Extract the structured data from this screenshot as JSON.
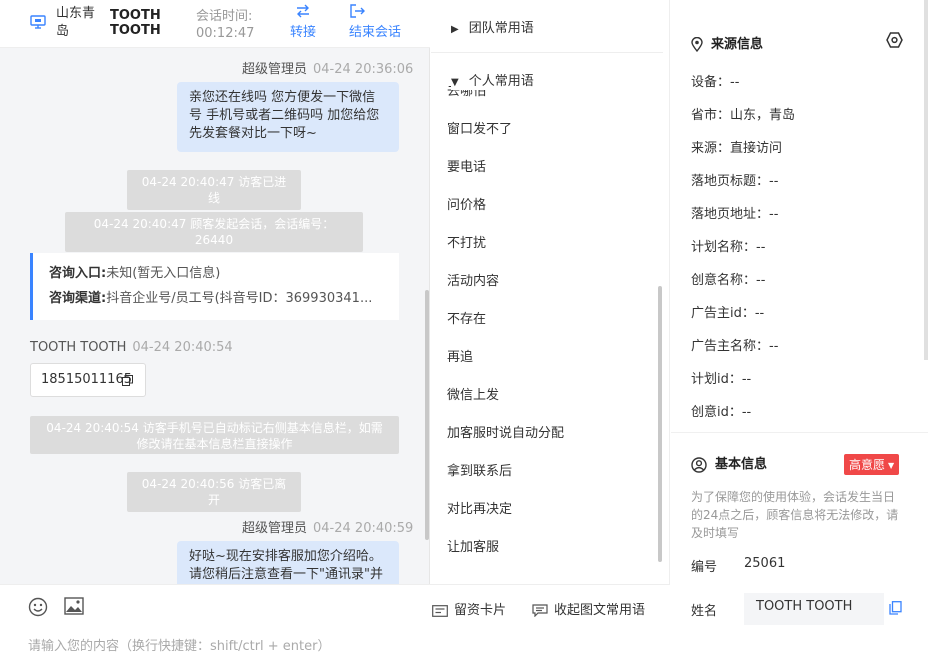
{
  "header": {
    "location": "山东青岛",
    "customer_name": "TOOTH TOOTH",
    "session_time_label": "会话时间:",
    "session_time": "00:12:47",
    "transfer_label": "转接",
    "end_label": "结束会话"
  },
  "messages": {
    "m1_sender": "超级管理员",
    "m1_time": "04-24 20:36:06",
    "m1_text": "亲您还在线吗 您方便发一下微信号 手机号或者二维码吗 加您给您先发套餐对比一下呀~",
    "sys1": "04-24 20:40:47 访客已进线",
    "sys2": "04-24 20:40:47 顾客发起会话，会话编号：26440",
    "source_entry_label": "咨询入口:",
    "source_entry_value": "未知(暂无入口信息)",
    "source_channel_label": "咨询渠道:",
    "source_channel_value": "抖音企业号/员工号(抖音号ID：369930341...",
    "m2_sender": "TOOTH TOOTH",
    "m2_time": "04-24 20:40:54",
    "m2_phone": "18515011165",
    "sys3": "04-24 20:40:54 访客手机号已自动标记右侧基本信息栏，如需修改请在基本信息栏直接操作",
    "sys4": "04-24 20:40:56 访客已离开",
    "m3_sender": "超级管理员",
    "m3_time": "04-24 20:40:59",
    "m3_text": "好哒~现在安排客服加您介绍哈。请您稍后注意查看一下\"通讯录\"并"
  },
  "input": {
    "card_label": "留资卡片",
    "collapse_label": "收起图文常用语",
    "placeholder": "请输入您的内容（换行快捷键：shift/ctrl + enter）"
  },
  "phrases": {
    "team_label": "团队常用语",
    "personal_label": "个人常用语",
    "partial_item": "去哪怕",
    "items": [
      "窗口发不了",
      "要电话",
      "问价格",
      "不打扰",
      "活动内容",
      "不存在",
      "再追",
      "微信上发",
      "加客服时说自动分配",
      "拿到联系后",
      "对比再决定",
      "让加客服"
    ]
  },
  "info": {
    "source_title": "来源信息",
    "device": "设备：--",
    "province": "省市：山东，青岛",
    "origin": "来源：直接访问",
    "landing_title": "落地页标题：--",
    "landing_url": "落地页地址：--",
    "plan_name": "计划名称：--",
    "creative_name": "创意名称：--",
    "advertiser_id": "广告主id：--",
    "advertiser_name": "广告主名称：--",
    "plan_id": "计划id：--",
    "creative_id": "创意id：--",
    "basic_title": "基本信息",
    "intent": "高意愿",
    "notice": "为了保障您的使用体验，会话发生当日的24点之后，顾客信息将无法修改，请及时填写",
    "id_label": "编号",
    "id_value": "25061",
    "name_label": "姓名",
    "name_value": "TOOTH TOOTH"
  },
  "colors": {
    "accent": "#3a84ff",
    "agent_bubble": "#dbe8fb",
    "system_msg": "#dcdcdc",
    "intent_badge": "#f04848"
  }
}
